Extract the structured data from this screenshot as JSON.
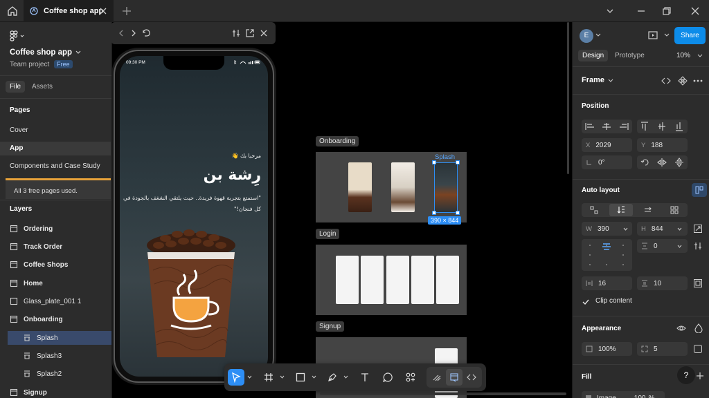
{
  "titlebar": {
    "tab_title": "Coffee shop app"
  },
  "left_panel": {
    "project_name": "Coffee shop app",
    "team": "Team project",
    "plan_badge": "Free",
    "tabs": {
      "file": "File",
      "assets": "Assets"
    },
    "pages_title": "Pages",
    "pages": [
      {
        "label": "Cover"
      },
      {
        "label": "App"
      },
      {
        "label": "Components and Case Study"
      }
    ],
    "notice": "All 3 free pages used.",
    "layers_title": "Layers",
    "layers": [
      {
        "label": "Ordering",
        "icon": "frame-icon"
      },
      {
        "label": "Track Order",
        "icon": "frame-icon"
      },
      {
        "label": "Coffee Shops",
        "icon": "frame-icon"
      },
      {
        "label": "Home",
        "icon": "frame-icon"
      },
      {
        "label": "Glass_plate_001 1",
        "icon": "image-icon"
      },
      {
        "label": "Onboarding",
        "icon": "frame-icon"
      },
      {
        "label": "Splash",
        "icon": "component-icon"
      },
      {
        "label": "Splash3",
        "icon": "component-icon"
      },
      {
        "label": "Splash2",
        "icon": "component-icon"
      },
      {
        "label": "Signup",
        "icon": "frame-icon"
      }
    ]
  },
  "canvas": {
    "phone": {
      "time": "09:30 PM",
      "welcome": "مرحبا بك 👋",
      "brand": "رِشة بن",
      "tagline": "\"استمتع بتجربة قهوة فريدة.. حيث يلتقي الشغف بالجودة في كل فنجان!\""
    },
    "frames": [
      {
        "label": "Onboarding"
      },
      {
        "label": "Login"
      },
      {
        "label": "Signup"
      }
    ],
    "selected_frame_label": "Splash",
    "selected_size": "390 × 844"
  },
  "right_panel": {
    "avatar_initial": "E",
    "share_label": "Share",
    "tabs": {
      "design": "Design",
      "prototype": "Prototype"
    },
    "zoom": "10%",
    "frame_title": "Frame",
    "position_title": "Position",
    "x": {
      "label": "X",
      "value": "2029"
    },
    "y": {
      "label": "Y",
      "value": "188"
    },
    "rotation": "0°",
    "auto_layout_title": "Auto layout",
    "w": {
      "label": "W",
      "value": "390"
    },
    "h": {
      "label": "H",
      "value": "844"
    },
    "gap_value": "0",
    "padding_h": "16",
    "padding_v": "10",
    "clip_content": "Clip content",
    "appearance_title": "Appearance",
    "opacity": "100%",
    "radius": "5",
    "fill_title": "Fill",
    "fill_type": "Image",
    "fill_opacity": "100",
    "fill_unit": "%",
    "help": "?"
  },
  "colors": {
    "accent": "#0d8ce9",
    "selection": "#2d8ef5",
    "panel": "#2c2c2c",
    "canvas": "#000000",
    "warning": "#e8a23a"
  }
}
